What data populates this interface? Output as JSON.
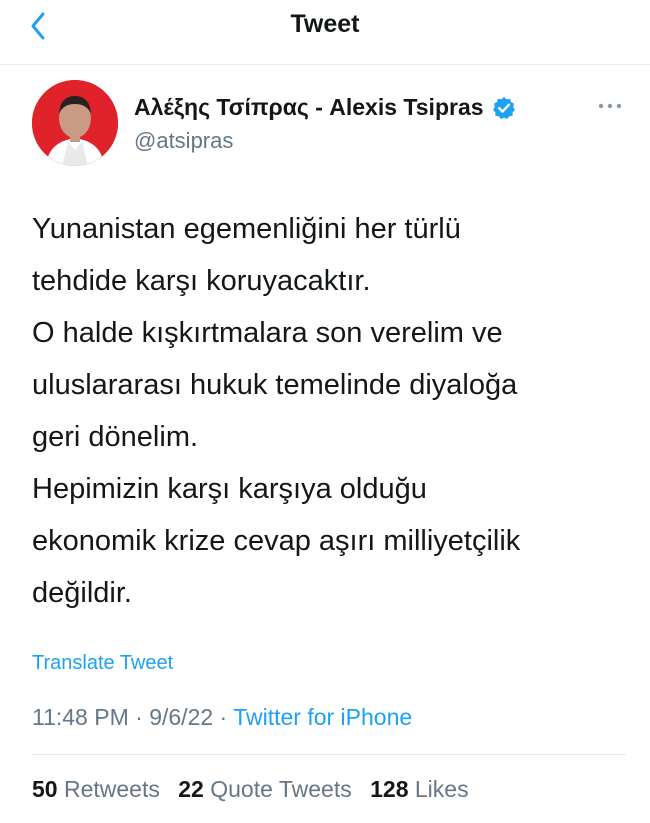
{
  "header": {
    "title": "Tweet"
  },
  "author": {
    "name": "Αλέξης Τσίπρας - Alexis Tsipras",
    "handle": "@atsipras"
  },
  "tweet": {
    "lines": [
      "Yunanistan egemenliğini her türlü",
      "tehdide karşı koruyacaktır.",
      "O halde kışkırtmalara son verelim ve",
      "uluslararası hukuk temelinde diyaloğa",
      "geri dönelim.",
      "Hepimizin karşı karşıya olduğu",
      "ekonomik krize cevap aşırı milliyetçilik",
      "değildir."
    ],
    "translate_label": "Translate Tweet",
    "time": "11:48 PM",
    "separator": "·",
    "date": "9/6/22",
    "source": "Twitter for iPhone"
  },
  "stats": {
    "retweets_count": "50",
    "retweets_label": "Retweets",
    "quotes_count": "22",
    "quotes_label": "Quote Tweets",
    "likes_count": "128",
    "likes_label": "Likes"
  },
  "colors": {
    "accent": "#1da1f2",
    "secondary_text": "#657786",
    "avatar_bg": "#e0222b"
  },
  "icons": {
    "back": "chevron-left-icon",
    "verified": "verified-badge-icon",
    "more": "more-horizontal-icon"
  }
}
